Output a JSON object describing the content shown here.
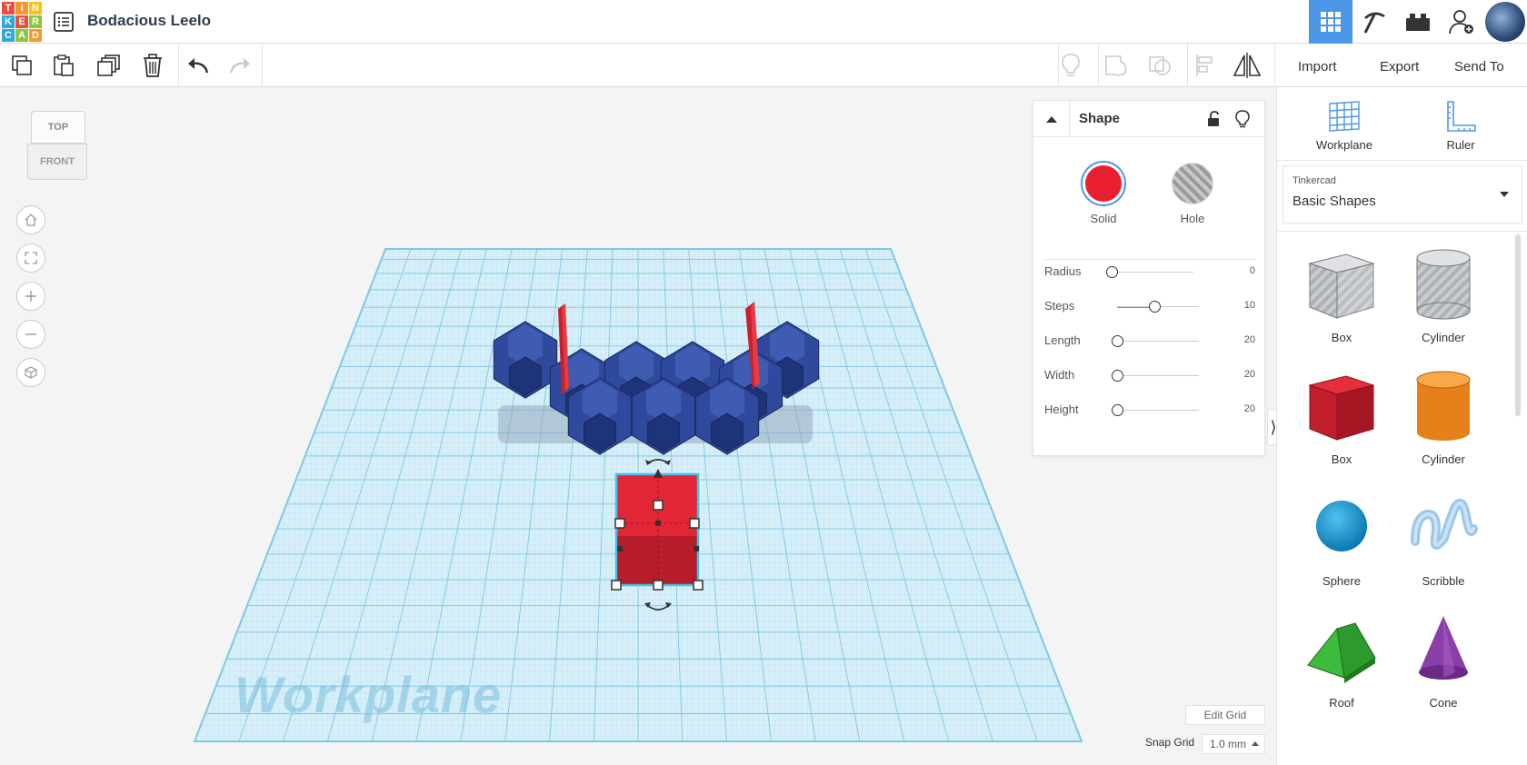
{
  "app": {
    "logo_letters": [
      "T",
      "I",
      "N",
      "K",
      "E",
      "R",
      "C",
      "A",
      "D"
    ],
    "logo_colors": [
      "#e94f3c",
      "#f39a2d",
      "#f5c21b",
      "#2aa9de",
      "#e94f3c",
      "#8cc63f",
      "#2aa9de",
      "#8cc63f",
      "#f39a2d"
    ],
    "project_title": "Bodacious Leelo"
  },
  "top_icons": [
    "grid-view-icon",
    "pickaxe-icon",
    "brick-icon",
    "add-user-icon"
  ],
  "toolbar": {
    "import_label": "Import",
    "export_label": "Export",
    "send_to_label": "Send To"
  },
  "viewcube": {
    "top": "TOP",
    "front": "FRONT"
  },
  "workplane": {
    "label": "Workplane",
    "edit_grid": "Edit Grid",
    "snap_grid_label": "Snap Grid",
    "snap_grid_value": "1.0 mm"
  },
  "inspector": {
    "title": "Shape",
    "solid_label": "Solid",
    "hole_label": "Hole",
    "solid_color": "#e8202f",
    "params": [
      {
        "name": "Radius",
        "value": "0",
        "fraction": 0.0
      },
      {
        "name": "Steps",
        "value": "10",
        "fraction": 0.45
      },
      {
        "name": "Length",
        "value": "20",
        "fraction": 0.0
      },
      {
        "name": "Width",
        "value": "20",
        "fraction": 0.0
      },
      {
        "name": "Height",
        "value": "20",
        "fraction": 0.0
      }
    ]
  },
  "right_panel": {
    "workplane_label": "Workplane",
    "ruler_label": "Ruler",
    "library_small": "Tinkercad",
    "library_name": "Basic Shapes",
    "shapes": [
      {
        "label": "Box",
        "kind": "box-hole"
      },
      {
        "label": "Cylinder",
        "kind": "cylinder-hole"
      },
      {
        "label": "Box",
        "kind": "box"
      },
      {
        "label": "Cylinder",
        "kind": "cylinder"
      },
      {
        "label": "Sphere",
        "kind": "sphere"
      },
      {
        "label": "Scribble",
        "kind": "scribble"
      },
      {
        "label": "Roof",
        "kind": "roof"
      },
      {
        "label": "Cone",
        "kind": "cone"
      }
    ]
  }
}
